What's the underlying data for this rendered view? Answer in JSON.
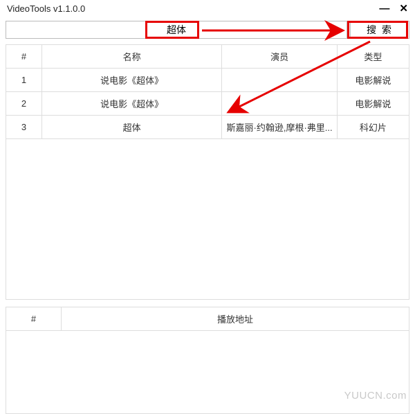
{
  "window": {
    "title": "VideoTools v1.1.0.0"
  },
  "search": {
    "value": "超体",
    "button_label": "搜索"
  },
  "results": {
    "headers": {
      "index": "#",
      "name": "名称",
      "actor": "演员",
      "type": "类型"
    },
    "rows": [
      {
        "index": "1",
        "name": "说电影《超体》",
        "actor": "",
        "type": "电影解说"
      },
      {
        "index": "2",
        "name": "说电影《超体》",
        "actor": "",
        "type": "电影解说"
      },
      {
        "index": "3",
        "name": "超体",
        "actor": "斯嘉丽·约翰逊,摩根·弗里...",
        "type": "科幻片"
      }
    ]
  },
  "playlist": {
    "headers": {
      "index": "#",
      "url": "播放地址"
    }
  },
  "watermark": "YUUCN.com"
}
